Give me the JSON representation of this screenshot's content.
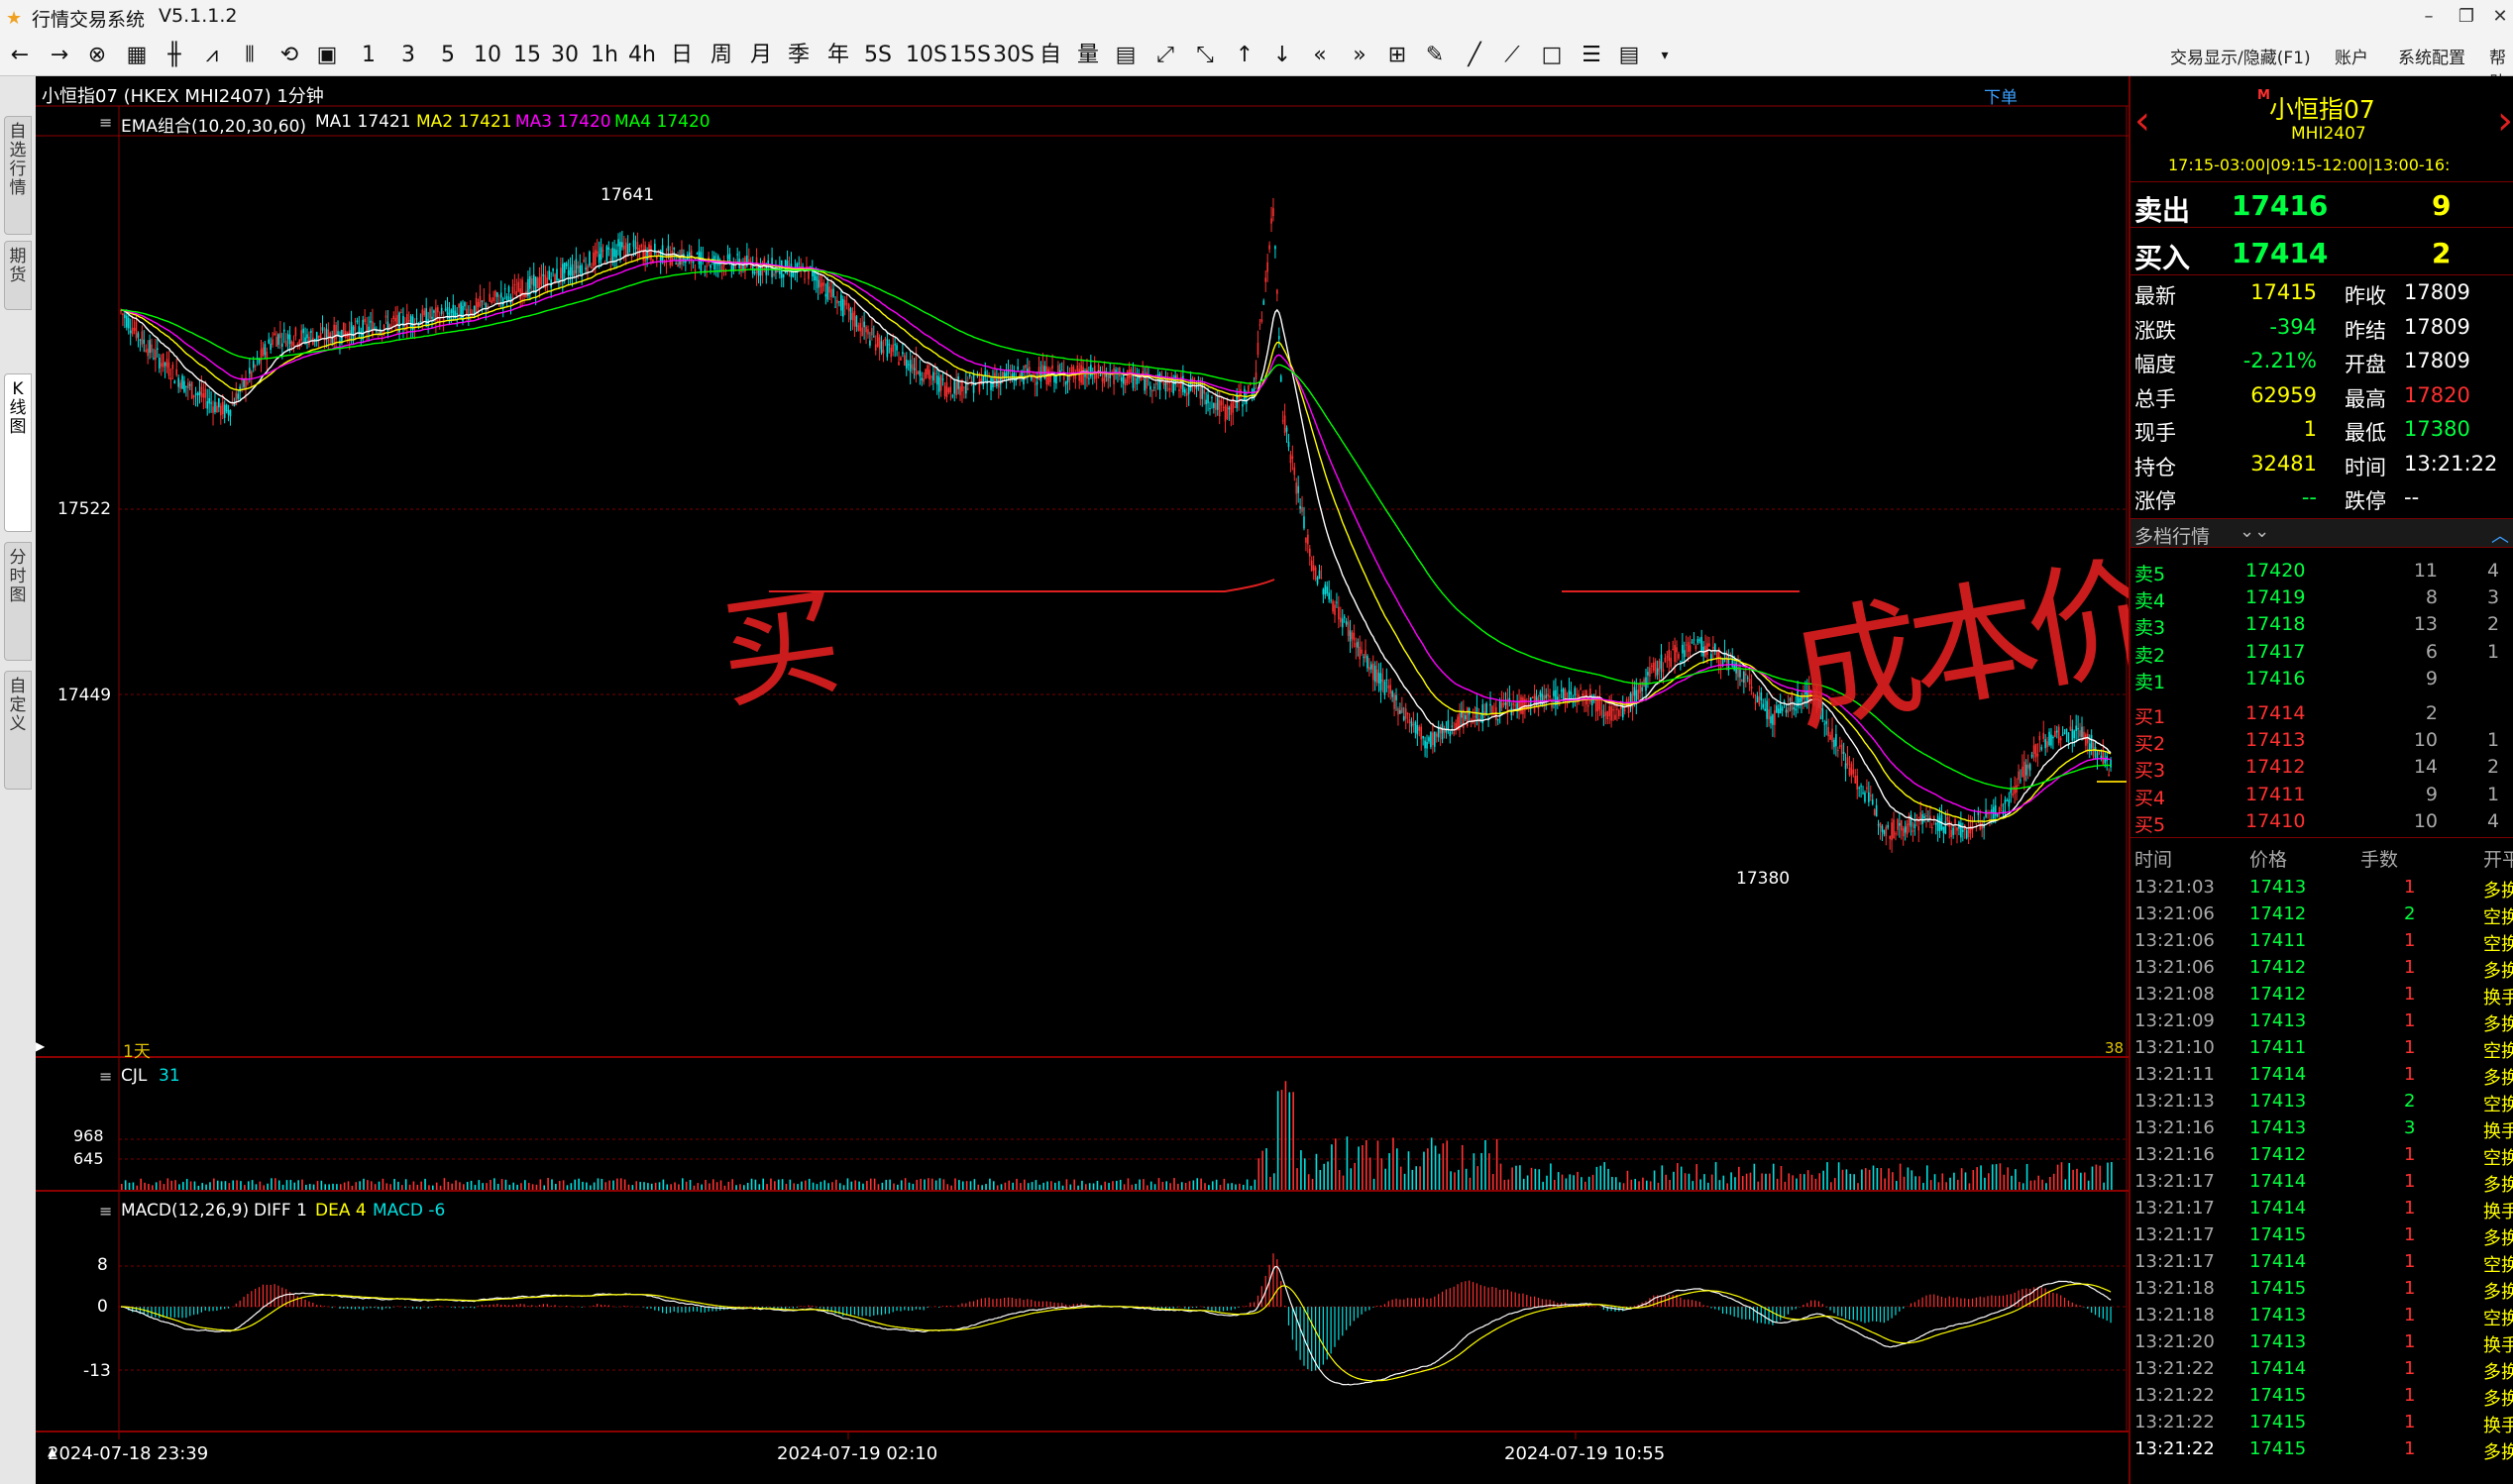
{
  "window": {
    "title": "行情交易系统",
    "version": "V5.1.1.2"
  },
  "toolbar": {
    "nav": [
      "←",
      "→"
    ],
    "periods": [
      "1",
      "3",
      "5",
      "10",
      "15",
      "30",
      "1h",
      "4h",
      "日",
      "周",
      "月",
      "季",
      "年",
      "5S",
      "10S",
      "15S",
      "30S",
      "自",
      "量"
    ],
    "right": [
      "交易显示/隐藏(F1)",
      "账户",
      "系统配置",
      "帮助"
    ]
  },
  "left_tabs": [
    "自选行情",
    "期货",
    "K线图",
    "分时图",
    "自定义"
  ],
  "chart": {
    "header": "小恒指07 (HKEX MHI2407) 1分钟",
    "order_link": "下单",
    "ema_label": "EMA组合(10,20,30,60)",
    "ma1": "MA1 17421",
    "ma2": "MA2 17421",
    "ma3": "MA3 17420",
    "ma4": "MA4 17420",
    "high_mark": "17641",
    "low_mark": "17380",
    "price_levels": [
      "17522",
      "17449"
    ],
    "period_tag": "1天",
    "count_tag": "38",
    "annotation_left": "买",
    "annotation_right": "成本价",
    "cjl_label": "CJL",
    "cjl_value": "31",
    "vol_levels": [
      "968",
      "645"
    ],
    "macd_label": "MACD(12,26,9)",
    "diff": "DIFF 1",
    "dea": "DEA 4",
    "macd": "MACD -6",
    "macd_levels": [
      "8",
      "0",
      "-13"
    ],
    "time_axis": [
      "2024-07-18 23:39",
      "2024-07-19 02:10",
      "2024-07-19 10:55"
    ],
    "colors": {
      "up": "#ff3030",
      "down": "#00e0e0",
      "ma1": "#ffffff",
      "ma2": "#ffff00",
      "ma3": "#ff00ff",
      "ma4": "#00ff00"
    }
  },
  "quote": {
    "name": "小恒指07",
    "code": "MHI2407",
    "tag": "M",
    "sessions": "17:15-03:00|09:15-12:00|13:00-16:",
    "sell": {
      "label": "卖出",
      "price": "17416",
      "qty": "9"
    },
    "buy": {
      "label": "买入",
      "price": "17414",
      "qty": "2"
    },
    "stats": [
      [
        "最新",
        "17415",
        "昨收",
        "17809"
      ],
      [
        "涨跌",
        "-394",
        "昨结",
        "17809"
      ],
      [
        "幅度",
        "-2.21%",
        "开盘",
        "17809"
      ],
      [
        "总手",
        "62959",
        "最高",
        "17820"
      ],
      [
        "现手",
        "1",
        "最低",
        "17380"
      ],
      [
        "持仓",
        "32481",
        "时间",
        "13:21:22"
      ],
      [
        "涨停",
        "--",
        "跌停",
        "--"
      ]
    ],
    "depth_title": "多档行情",
    "asks": [
      [
        "卖5",
        "17420",
        "11",
        "4"
      ],
      [
        "卖4",
        "17419",
        "8",
        "3"
      ],
      [
        "卖3",
        "17418",
        "13",
        "2"
      ],
      [
        "卖2",
        "17417",
        "6",
        "1"
      ],
      [
        "卖1",
        "17416",
        "9",
        ""
      ]
    ],
    "bids": [
      [
        "买1",
        "17414",
        "2",
        ""
      ],
      [
        "买2",
        "17413",
        "10",
        "1"
      ],
      [
        "买3",
        "17412",
        "14",
        "2"
      ],
      [
        "买4",
        "17411",
        "9",
        "1"
      ],
      [
        "买5",
        "17410",
        "10",
        "4"
      ]
    ],
    "ticks_header": [
      "时间",
      "价格",
      "手数",
      "开平"
    ],
    "ticks": [
      [
        "13:21:03",
        "17413",
        "1",
        "多换"
      ],
      [
        "13:21:06",
        "17412",
        "2",
        "空换"
      ],
      [
        "13:21:06",
        "17411",
        "1",
        "空换"
      ],
      [
        "13:21:06",
        "17412",
        "1",
        "多换"
      ],
      [
        "13:21:08",
        "17412",
        "1",
        "换手"
      ],
      [
        "13:21:09",
        "17413",
        "1",
        "多换"
      ],
      [
        "13:21:10",
        "17411",
        "1",
        "空换"
      ],
      [
        "13:21:11",
        "17414",
        "1",
        "多换"
      ],
      [
        "13:21:13",
        "17413",
        "2",
        "空换"
      ],
      [
        "13:21:16",
        "17413",
        "3",
        "换手"
      ],
      [
        "13:21:16",
        "17412",
        "1",
        "空换"
      ],
      [
        "13:21:17",
        "17414",
        "1",
        "多换"
      ],
      [
        "13:21:17",
        "17414",
        "1",
        "换手"
      ],
      [
        "13:21:17",
        "17415",
        "1",
        "多换"
      ],
      [
        "13:21:17",
        "17414",
        "1",
        "空换"
      ],
      [
        "13:21:18",
        "17415",
        "1",
        "多换"
      ],
      [
        "13:21:18",
        "17413",
        "1",
        "空换"
      ],
      [
        "13:21:20",
        "17413",
        "1",
        "换手"
      ],
      [
        "13:21:22",
        "17414",
        "1",
        "多换"
      ],
      [
        "13:21:22",
        "17415",
        "1",
        "多换"
      ],
      [
        "13:21:22",
        "17415",
        "1",
        "换手"
      ],
      [
        "13:21:22",
        "17415",
        "1",
        "多换"
      ]
    ]
  }
}
